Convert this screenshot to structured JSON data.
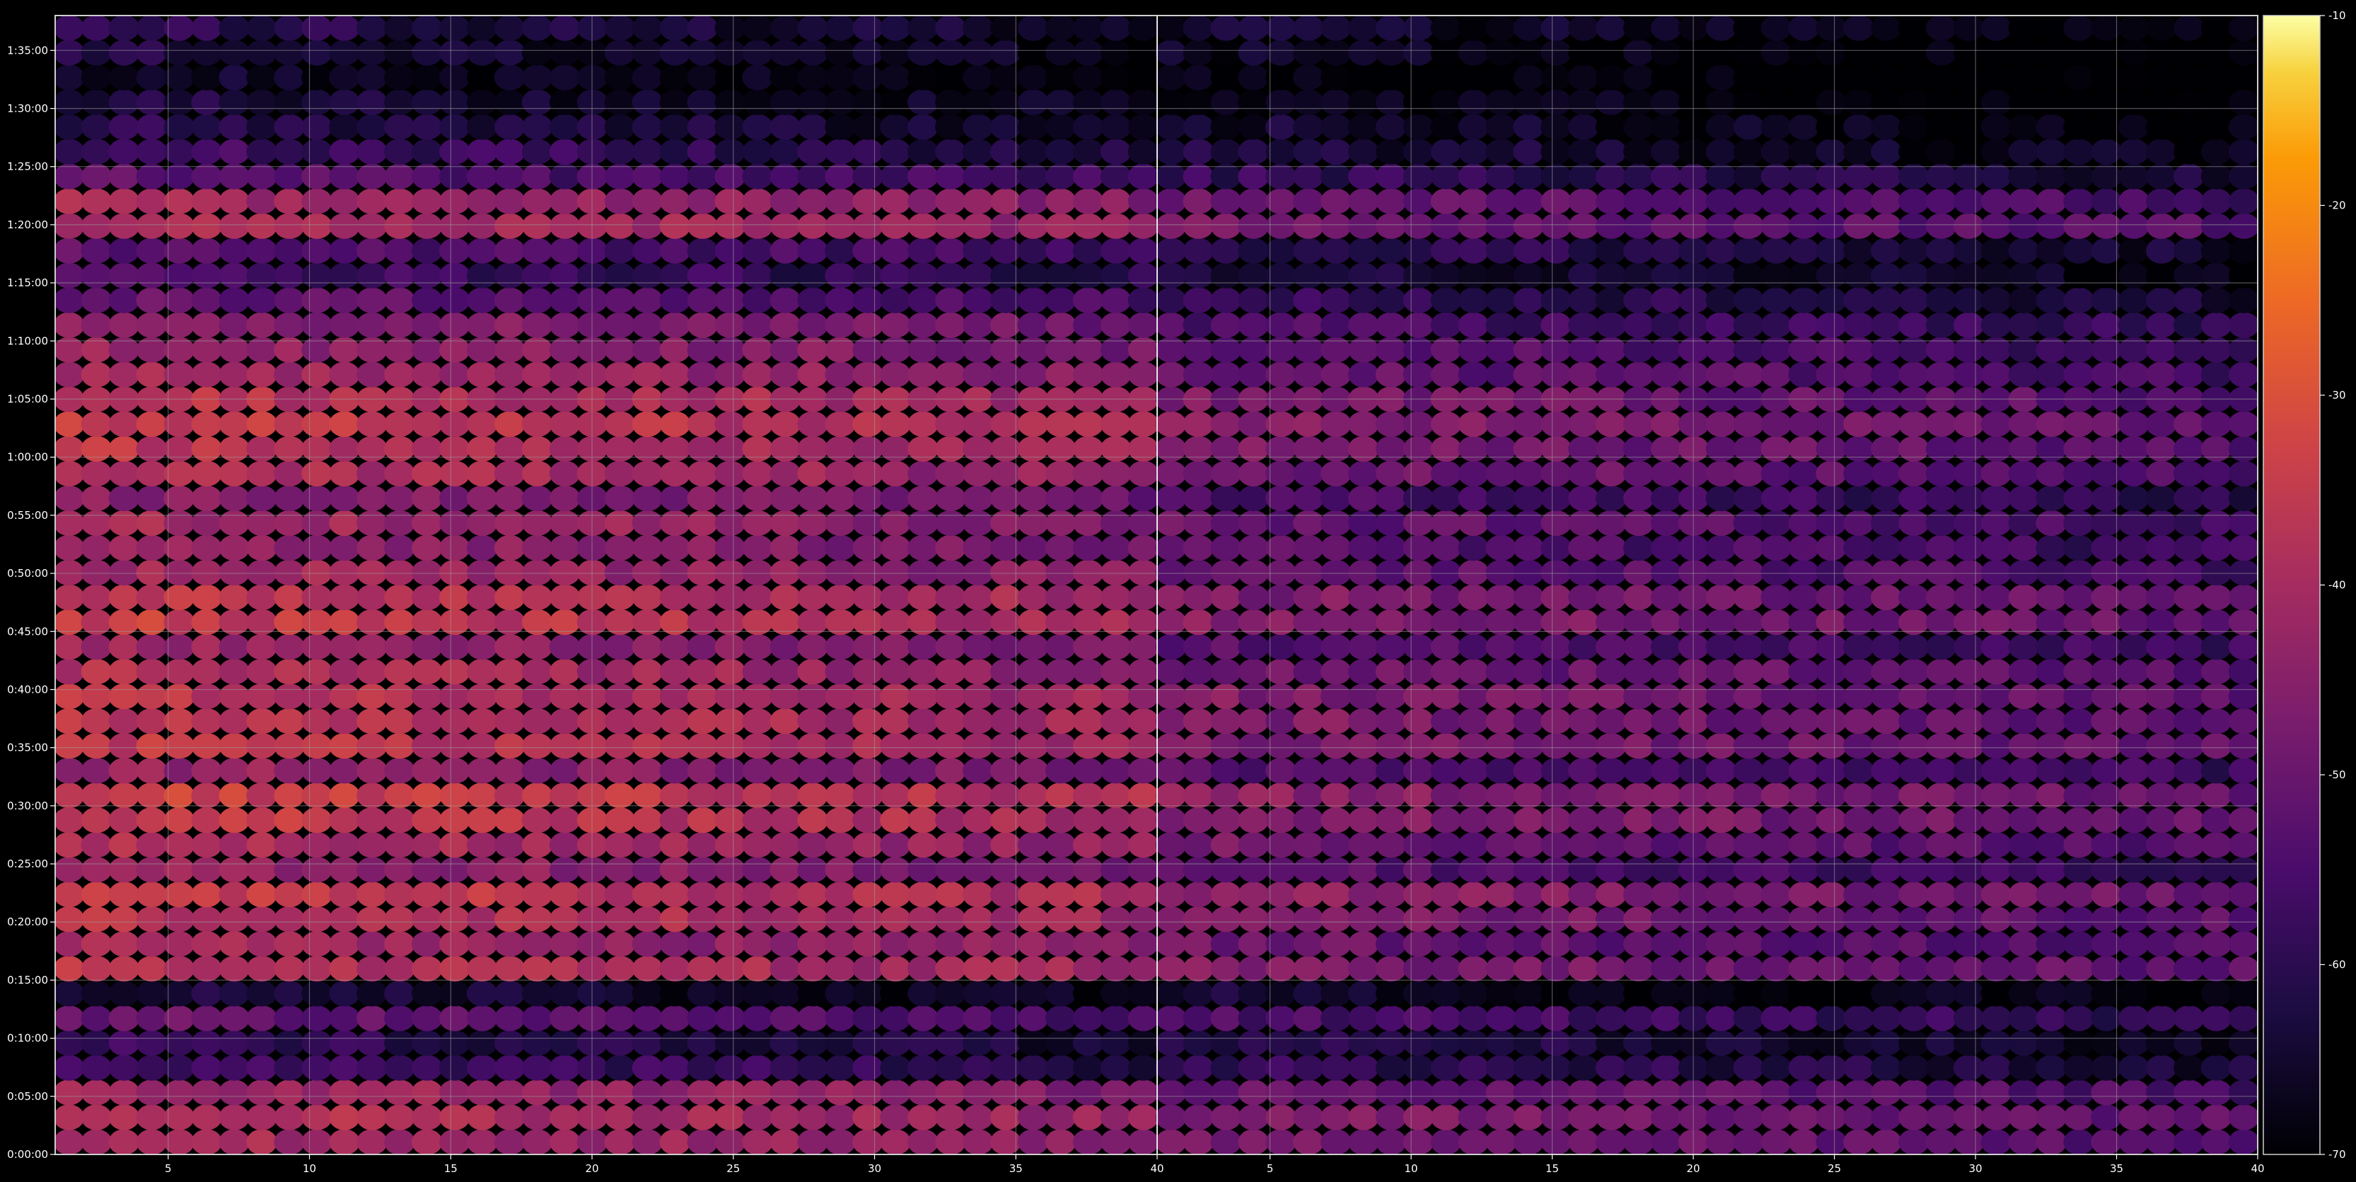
{
  "chart_data": {
    "type": "heatmap",
    "title": "",
    "xlabel": "",
    "ylabel": "",
    "panels": [
      {
        "name": "",
        "xlim": [
          1,
          40
        ],
        "xticks": [
          5,
          10,
          15,
          20,
          25,
          30,
          35,
          40
        ],
        "xtick_labels": [
          "5",
          "10",
          "15",
          "20",
          "25",
          "30",
          "35",
          "40"
        ],
        "mean_db_by_row": [
          -39,
          -37,
          -40,
          -55,
          -58,
          -50,
          -62,
          -36,
          -40,
          -36,
          -34,
          -42,
          -38,
          -34,
          -33,
          -42,
          -35,
          -36,
          -36,
          -38,
          -42,
          -34,
          -35,
          -40,
          -42,
          -40,
          -44,
          -38,
          -36,
          -34,
          -36,
          -40,
          -42,
          -44,
          -50,
          -55,
          -52,
          -38,
          -40,
          -52,
          -56,
          -60,
          -62,
          -64,
          -62,
          -60
        ]
      },
      {
        "name": "",
        "xlim": [
          1,
          40
        ],
        "xticks": [
          5,
          10,
          15,
          20,
          25,
          30,
          35,
          40
        ],
        "xtick_labels": [
          "5",
          "10",
          "15",
          "20",
          "25",
          "30",
          "35",
          "40"
        ],
        "mean_db_by_row": [
          -48,
          -46,
          -49,
          -58,
          -60,
          -54,
          -64,
          -46,
          -49,
          -46,
          -44,
          -52,
          -48,
          -45,
          -44,
          -52,
          -46,
          -46,
          -46,
          -48,
          -52,
          -45,
          -46,
          -50,
          -52,
          -50,
          -54,
          -48,
          -47,
          -45,
          -47,
          -50,
          -52,
          -54,
          -58,
          -62,
          -59,
          -48,
          -50,
          -58,
          -62,
          -64,
          -66,
          -68,
          -66,
          -64
        ]
      }
    ],
    "y": {
      "label": "",
      "range_seconds": [
        0,
        5880
      ],
      "ticks": [
        "0:00:00",
        "0:05:00",
        "0:10:00",
        "0:15:00",
        "0:20:00",
        "0:25:00",
        "0:30:00",
        "0:35:00",
        "0:40:00",
        "0:45:00",
        "0:50:00",
        "0:55:00",
        "1:00:00",
        "1:05:00",
        "1:10:00",
        "1:15:00",
        "1:20:00",
        "1:25:00",
        "1:30:00",
        "1:35:00"
      ]
    },
    "colorbar": {
      "colormap": "inferno",
      "range": [
        -70,
        -10
      ],
      "ticks": [
        "-10",
        "-20",
        "-30",
        "-40",
        "-50",
        "-60",
        "-70"
      ]
    },
    "grid": true,
    "legend": "none"
  }
}
